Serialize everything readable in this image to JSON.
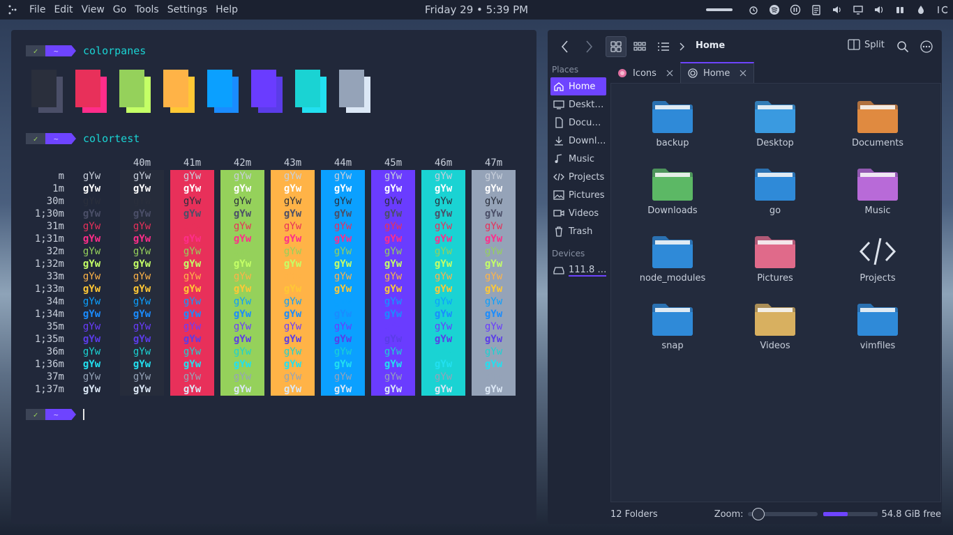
{
  "panel": {
    "menu": [
      "File",
      "Edit",
      "View",
      "Go",
      "Tools",
      "Settings",
      "Help"
    ],
    "clock": "Friday 29 • 5:39 PM",
    "tray_icons": [
      "volume-slider",
      "alarm-icon",
      "spotify-icon",
      "pause-icon",
      "clipboard-icon",
      "volume-icon",
      "display-icon",
      "audio-icon",
      "battery-icon",
      "drop-icon",
      "power-icon"
    ]
  },
  "terminal": {
    "cmd1": "colorpanes",
    "cmd2": "colortest",
    "ok": "✓",
    "tilde": "~",
    "panes": [
      {
        "front": "#2a2f3c",
        "back": "#4b4f68"
      },
      {
        "front": "#e8305a",
        "back": "#ff2d8a"
      },
      {
        "front": "#95d15b",
        "back": "#c4ff66"
      },
      {
        "front": "#ffb347",
        "back": "#ffc835"
      },
      {
        "front": "#0ba0ff",
        "back": "#1a8cff"
      },
      {
        "front": "#6a3cff",
        "back": "#5b3ce8"
      },
      {
        "front": "#1ad3d3",
        "back": "#22e0f0"
      },
      {
        "front": "#95a3b8",
        "back": "#dbe7f5"
      }
    ],
    "colortest": {
      "headers": [
        "40m",
        "41m",
        "42m",
        "43m",
        "44m",
        "45m",
        "46m",
        "47m"
      ],
      "bg_colors": [
        "#262c3b",
        "#e8305a",
        "#95d15b",
        "#ffb347",
        "#0ba0ff",
        "#6a3cff",
        "#1ad3d3",
        "#95a3b8"
      ],
      "rows": [
        {
          "label": "m",
          "color": "#c8cfdb",
          "bold": false
        },
        {
          "label": "1m",
          "color": "#ffffff",
          "bold": true
        },
        {
          "label": "30m",
          "color": "#2a2f3c",
          "bold": false
        },
        {
          "label": "1;30m",
          "color": "#4b4f68",
          "bold": true
        },
        {
          "label": "31m",
          "color": "#e8305a",
          "bold": false
        },
        {
          "label": "1;31m",
          "color": "#ff2d8a",
          "bold": true
        },
        {
          "label": "32m",
          "color": "#95d15b",
          "bold": false
        },
        {
          "label": "1;32m",
          "color": "#c4ff66",
          "bold": true
        },
        {
          "label": "33m",
          "color": "#ffb347",
          "bold": false
        },
        {
          "label": "1;33m",
          "color": "#ffc835",
          "bold": true
        },
        {
          "label": "34m",
          "color": "#0ba0ff",
          "bold": false
        },
        {
          "label": "1;34m",
          "color": "#1a8cff",
          "bold": true
        },
        {
          "label": "35m",
          "color": "#6a3cff",
          "bold": false
        },
        {
          "label": "1;35m",
          "color": "#5b3ce8",
          "bold": true
        },
        {
          "label": "36m",
          "color": "#1ad3d3",
          "bold": false
        },
        {
          "label": "1;36m",
          "color": "#22e0f0",
          "bold": true
        },
        {
          "label": "37m",
          "color": "#95a3b8",
          "bold": false
        },
        {
          "label": "1;37m",
          "color": "#dbe7f5",
          "bold": true
        }
      ],
      "sample": "gYw"
    }
  },
  "fm": {
    "title": "Home",
    "split_label": "Split",
    "places_header": "Places",
    "devices_header": "Devices",
    "places": [
      {
        "label": "Home",
        "icon": "home-icon"
      },
      {
        "label": "Deskt…",
        "icon": "desktop-icon"
      },
      {
        "label": "Docu…",
        "icon": "document-icon"
      },
      {
        "label": "Downl…",
        "icon": "download-icon"
      },
      {
        "label": "Music",
        "icon": "music-icon"
      },
      {
        "label": "Projects",
        "icon": "code-icon"
      },
      {
        "label": "Pictures",
        "icon": "picture-icon"
      },
      {
        "label": "Videos",
        "icon": "video-icon"
      },
      {
        "label": "Trash",
        "icon": "trash-icon"
      }
    ],
    "devices": [
      {
        "label": "111.8 …",
        "icon": "drive-icon"
      }
    ],
    "tabs": [
      {
        "label": "Icons",
        "icon": "icons-tab-icon"
      },
      {
        "label": "Home",
        "icon": "home-tab-icon"
      }
    ],
    "items": [
      {
        "name": "backup",
        "color": "#2f8ad8"
      },
      {
        "name": "Desktop",
        "color": "#3a9ae0"
      },
      {
        "name": "Documents",
        "color": "#e08a40"
      },
      {
        "name": "Downloads",
        "color": "#5cb865"
      },
      {
        "name": "go",
        "color": "#2f8ad8"
      },
      {
        "name": "Music",
        "color": "#b86ad8"
      },
      {
        "name": "node_modules",
        "color": "#2f8ad8"
      },
      {
        "name": "Pictures",
        "color": "#e06a8a"
      },
      {
        "name": "Projects",
        "color": "code"
      },
      {
        "name": "snap",
        "color": "#2f8ad8"
      },
      {
        "name": "Videos",
        "color": "#d8b060"
      },
      {
        "name": "vimfiles",
        "color": "#2f8ad8"
      }
    ],
    "status": {
      "folders": "12 Folders",
      "zoom_label": "Zoom:",
      "zoom_level": 0.15,
      "disk_used": 0.45,
      "free": "54.8 GiB free"
    }
  }
}
